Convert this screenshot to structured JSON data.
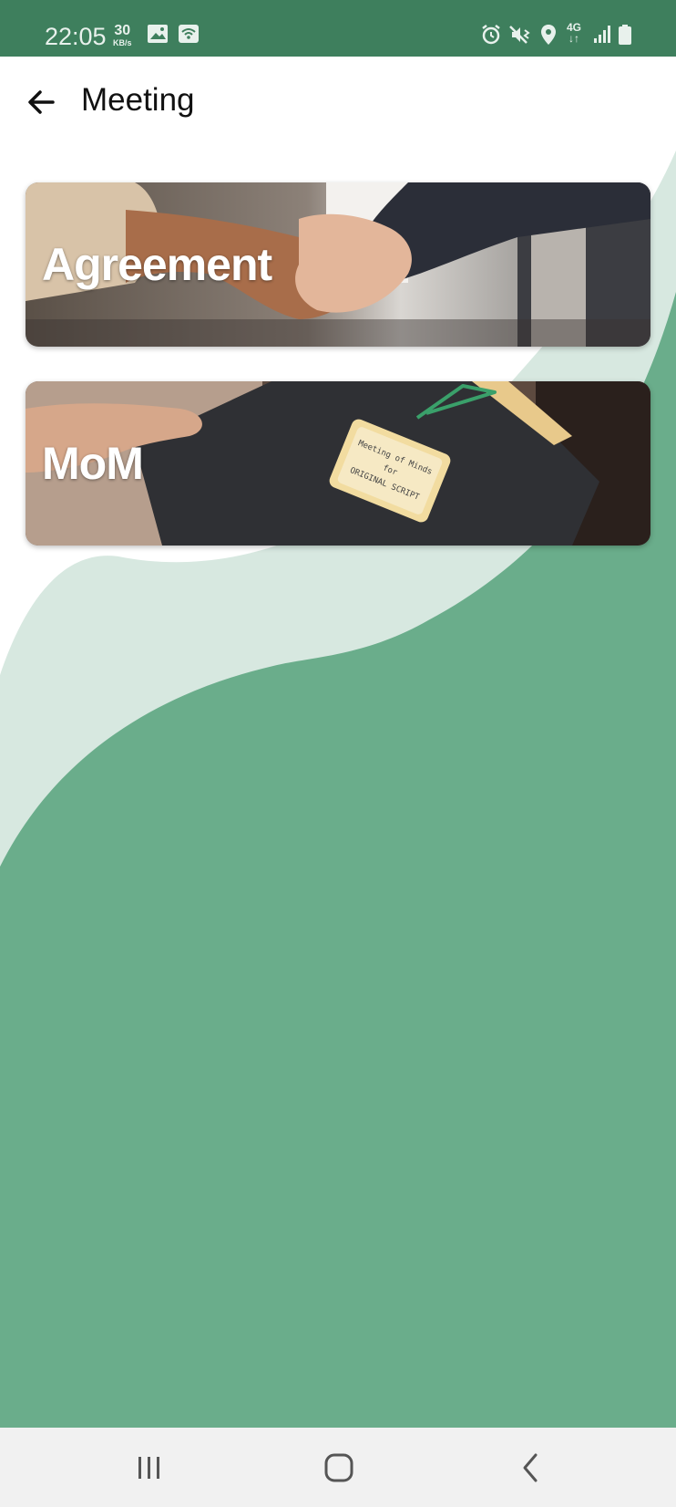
{
  "status_bar": {
    "time": "22:05",
    "net_speed": "30",
    "net_speed_unit": "KB/s",
    "network_type": "4G",
    "icons": [
      "gallery-icon",
      "wifi-hotspot-icon",
      "alarm-icon",
      "mute-vibrate-icon",
      "location-icon",
      "signal-icon",
      "battery-icon"
    ]
  },
  "header": {
    "title": "Meeting"
  },
  "cards": [
    {
      "label": "Agreement",
      "image": "handshake-photo"
    },
    {
      "label": "MoM",
      "image": "folder-photo"
    }
  ],
  "folder_note": [
    "Meeting of Minds",
    "for",
    "ORIGINAL SCRIPT"
  ],
  "colors": {
    "status_bar": "#3e7f5d",
    "wave_light": "#d7e8e0",
    "wave_dark": "#6aad8b",
    "nav_bar": "#f1f1f1"
  },
  "nav": {
    "icons": [
      "recent-apps-icon",
      "home-icon",
      "back-icon"
    ]
  }
}
